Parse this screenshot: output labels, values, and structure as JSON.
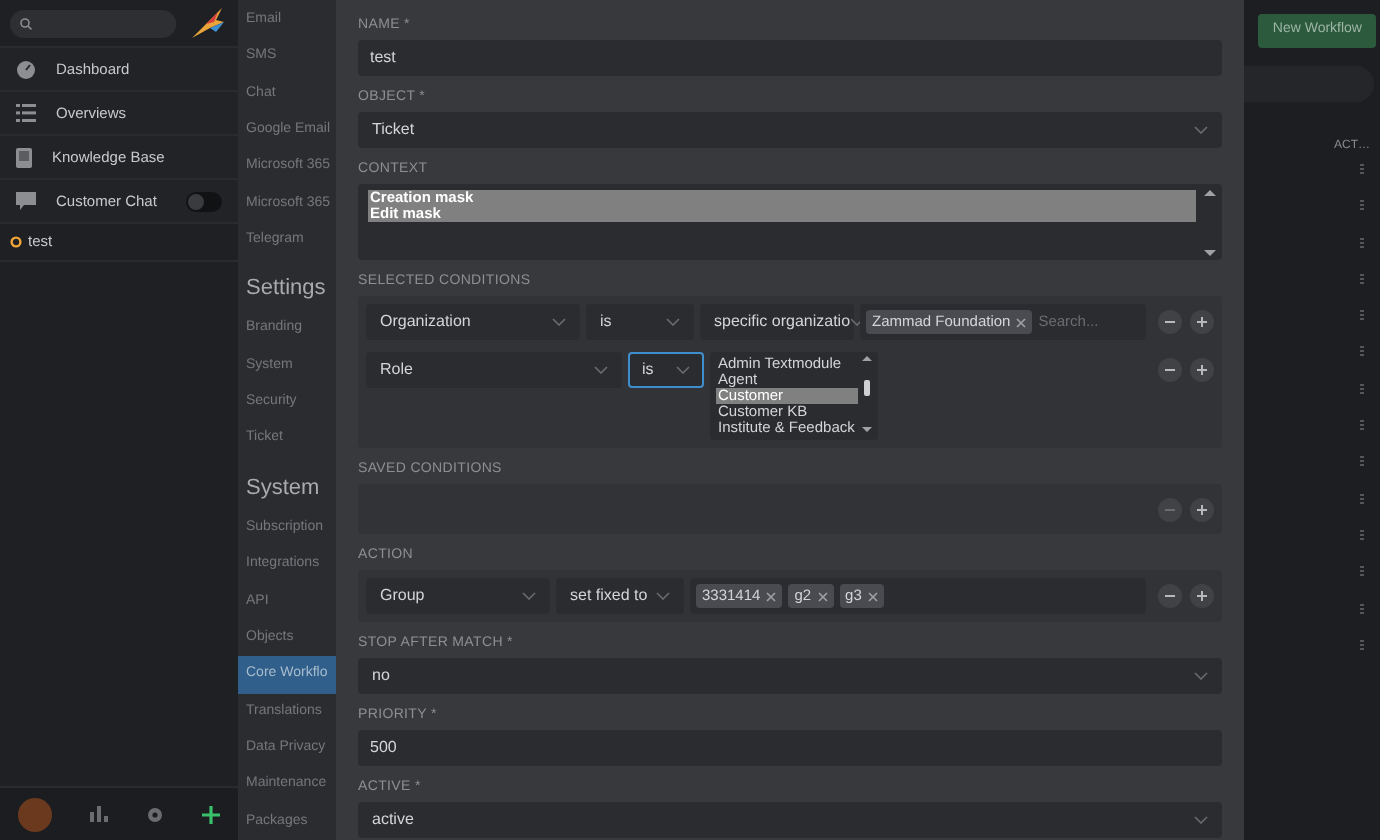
{
  "sidebar": {
    "nav": [
      {
        "label": "Dashboard",
        "kind": "dashboard"
      },
      {
        "label": "Overviews",
        "kind": "list"
      },
      {
        "label": "Knowledge Base",
        "kind": "book"
      },
      {
        "label": "Customer Chat",
        "kind": "chat",
        "toggle": {
          "on": false
        }
      }
    ],
    "recent": [
      {
        "label": "test"
      }
    ]
  },
  "admin_nav": [
    {
      "kind": "link",
      "label": "Email",
      "selected": false
    },
    {
      "kind": "link",
      "label": "SMS",
      "selected": false
    },
    {
      "kind": "link",
      "label": "Chat",
      "selected": false
    },
    {
      "kind": "link",
      "label": "Google Email",
      "selected": false
    },
    {
      "kind": "link",
      "label": "Microsoft 365",
      "selected": false
    },
    {
      "kind": "link",
      "label": "Microsoft 365",
      "selected": false
    },
    {
      "kind": "link",
      "label": "Telegram",
      "selected": false
    },
    {
      "kind": "header",
      "label": "Settings"
    },
    {
      "kind": "link",
      "label": "Branding",
      "selected": false
    },
    {
      "kind": "link",
      "label": "System",
      "selected": false
    },
    {
      "kind": "link",
      "label": "Security",
      "selected": false
    },
    {
      "kind": "link",
      "label": "Ticket",
      "selected": false
    },
    {
      "kind": "header",
      "label": "System"
    },
    {
      "kind": "link",
      "label": "Subscription",
      "selected": false
    },
    {
      "kind": "link",
      "label": "Integrations",
      "selected": false
    },
    {
      "kind": "link",
      "label": "API",
      "selected": false
    },
    {
      "kind": "link",
      "label": "Objects",
      "selected": false
    },
    {
      "kind": "link",
      "label": "Core Workflo",
      "selected": true
    },
    {
      "kind": "link",
      "label": "Translations",
      "selected": false
    },
    {
      "kind": "link",
      "label": "Data Privacy",
      "selected": false
    },
    {
      "kind": "link",
      "label": "Maintenance",
      "selected": false
    },
    {
      "kind": "link",
      "label": "Packages",
      "selected": false
    }
  ],
  "background": {
    "new_button": "New Workflow",
    "column_header": "ACT…"
  },
  "modal": {
    "name": {
      "label": "NAME *",
      "value": "test"
    },
    "object": {
      "label": "OBJECT *",
      "value": "Ticket"
    },
    "context": {
      "label": "CONTEXT",
      "options": [
        {
          "label": "Creation mask",
          "selected": true
        },
        {
          "label": "Edit mask",
          "selected": true
        }
      ]
    },
    "selected_conditions": {
      "label": "SELECTED CONDITIONS",
      "rows": [
        {
          "kind": "tokens",
          "attribute": "Organization",
          "operator": "is",
          "operator_focused": false,
          "pre_condition": "specific organizatio",
          "tokens": [
            "Zammad Foundation"
          ],
          "search_placeholder": "Search..."
        },
        {
          "kind": "list",
          "attribute": "Role",
          "operator": "is",
          "operator_focused": true,
          "options": [
            {
              "label": "Admin Textmodule",
              "selected": false
            },
            {
              "label": "Agent",
              "selected": false
            },
            {
              "label": "Customer",
              "selected": true
            },
            {
              "label": "Customer KB",
              "selected": false
            },
            {
              "label": "Institute & Feedback",
              "selected": false
            }
          ]
        }
      ]
    },
    "saved_conditions": {
      "label": "SAVED CONDITIONS"
    },
    "action": {
      "label": "ACTION",
      "attribute": "Group",
      "operator": "set fixed to",
      "tokens": [
        "3331414",
        "g2",
        "g3"
      ]
    },
    "stop_after_match": {
      "label": "STOP AFTER MATCH *",
      "value": "no"
    },
    "priority": {
      "label": "PRIORITY *",
      "value": "500"
    },
    "active": {
      "label": "ACTIVE *",
      "value": "active"
    }
  }
}
